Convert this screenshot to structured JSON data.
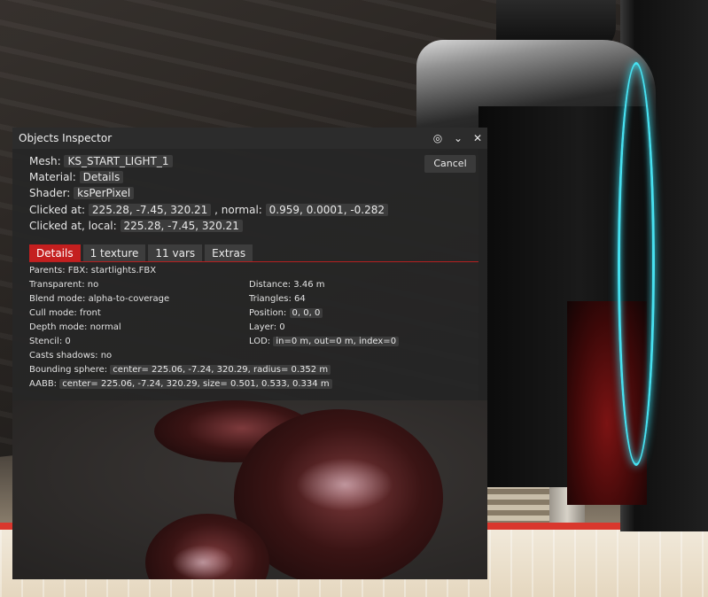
{
  "window": {
    "title": "Objects Inspector",
    "icons": [
      "target-icon",
      "chevron-down-icon",
      "close-icon"
    ],
    "close_glyph": "✕",
    "chevron_glyph": "⌄",
    "target_glyph": "◎"
  },
  "info": {
    "mesh_label": "Mesh:",
    "mesh_value": "KS_START_LIGHT_1",
    "material_label": "Material:",
    "material_value": "Details",
    "shader_label": "Shader:",
    "shader_value": "ksPerPixel",
    "clicked_label": "Clicked at:",
    "clicked_x": "225.28",
    "clicked_y": "-7.45",
    "clicked_z": "320.21",
    "normal_label": ", normal:",
    "normal_x": "0.959",
    "normal_y": "0.0001",
    "normal_z": "-0.282",
    "local_label": "Clicked at, local:",
    "local_x": "225.28",
    "local_y": "-7.45",
    "local_z": "320.21",
    "comma": ","
  },
  "buttons": {
    "cancel": "Cancel"
  },
  "tabs": [
    {
      "label": "Details",
      "active": true
    },
    {
      "label": "1 texture",
      "active": false
    },
    {
      "label": "11 vars",
      "active": false
    },
    {
      "label": "Extras",
      "active": false
    }
  ],
  "details": {
    "parents_label": "Parents:",
    "parents_value": "FBX: startlights.FBX",
    "transparent_label": "Transparent:",
    "transparent_value": "no",
    "blend_label": "Blend mode:",
    "blend_value": "alpha-to-coverage",
    "cull_label": "Cull mode:",
    "cull_value": "front",
    "depth_label": "Depth mode:",
    "depth_value": "normal",
    "stencil_label": "Stencil:",
    "stencil_value": "0",
    "shadows_label": "Casts shadows:",
    "shadows_value": "no",
    "distance_label": "Distance:",
    "distance_value": "3.46",
    "distance_unit": "m",
    "triangles_label": "Triangles:",
    "triangles_value": "64",
    "position_label": "Position:",
    "position_x": "0",
    "position_y": "0",
    "position_z": "0",
    "layer_label": "Layer:",
    "layer_value": "0",
    "lod_label": "LOD:",
    "lod_in_label": "in=",
    "lod_in_value": "0",
    "lod_in_unit": "m,",
    "lod_out_label": "out=",
    "lod_out_value": "0",
    "lod_out_unit": "m,",
    "lod_index_label": "index=",
    "lod_index_value": "0",
    "sphere_label": "Bounding sphere:",
    "sphere_center_label": "center=",
    "sphere_cx": "225.06",
    "sphere_cy": "-7.24",
    "sphere_cz": "320.29",
    "sphere_radius_label": ", radius=",
    "sphere_radius": "0.352",
    "sphere_unit": "m",
    "aabb_label": "AABB:",
    "aabb_center_label": "center=",
    "aabb_cx": "225.06",
    "aabb_cy": "-7.24",
    "aabb_cz": "320.29",
    "aabb_size_label": ", size=",
    "aabb_sx": "0.501",
    "aabb_sy": "0.533",
    "aabb_sz": "0.334",
    "aabb_unit": "m"
  },
  "colors": {
    "accent": "#c41f1f",
    "window_bg": "#262626",
    "ring_glow": "#47e0f0"
  }
}
